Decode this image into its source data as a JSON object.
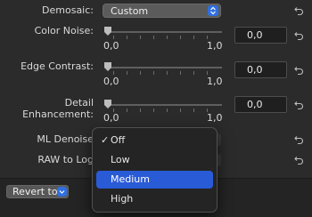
{
  "inspector": {
    "demosaic": {
      "label": "Demosaic:",
      "value": "Custom"
    },
    "color_noise": {
      "label": "Color Noise:",
      "min": "0,0",
      "max": "1,0",
      "value": "0,0"
    },
    "edge_contrast": {
      "label": "Edge Contrast:",
      "min": "0,0",
      "max": "1,0",
      "value": "0,0"
    },
    "detail_enhancement": {
      "label_line1": "Detail",
      "label_line2": "Enhancement:",
      "min": "0,0",
      "max": "1,0",
      "value": "0,0"
    },
    "ml_denoise": {
      "label": "ML Denoise"
    },
    "raw_to_log": {
      "label": "RAW to Log"
    }
  },
  "footer": {
    "revert_label": "Revert to"
  },
  "menu": {
    "items": [
      {
        "label": "Off",
        "checked": true
      },
      {
        "label": "Low",
        "checked": false
      },
      {
        "label": "Medium",
        "checked": false,
        "highlighted": true
      },
      {
        "label": "High",
        "checked": false
      }
    ],
    "check_glyph": "✓"
  },
  "colors": {
    "background": "#2b2b2b",
    "accent": "#2f6fe0",
    "menu_highlight": "#2a5bd7"
  },
  "icons": [
    "chevron-updown-icon",
    "reset-arrow-icon",
    "slider-thumb-icon",
    "checkmark-icon"
  ]
}
